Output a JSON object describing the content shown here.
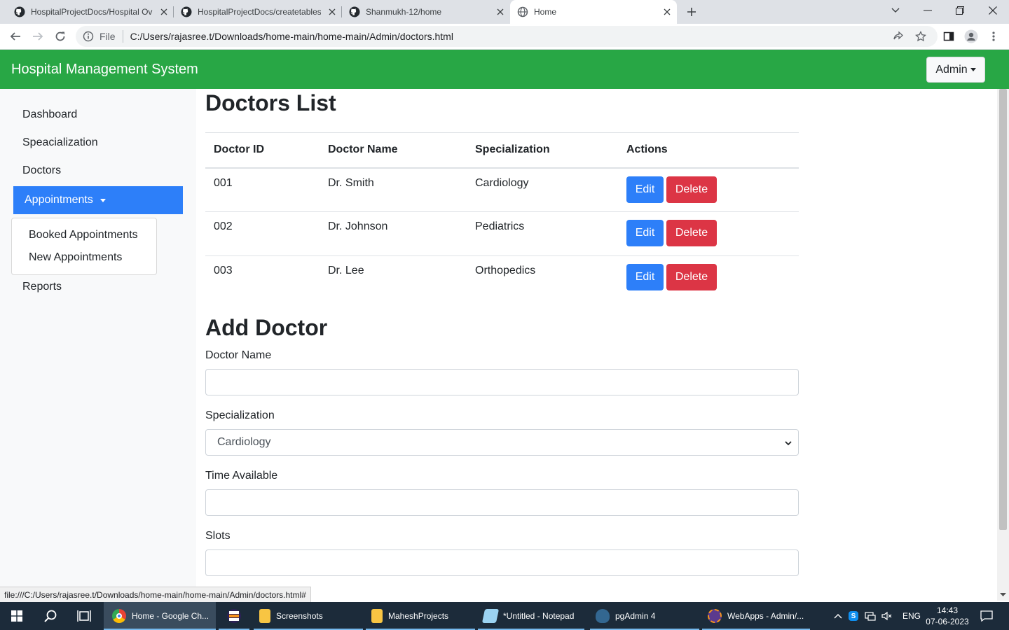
{
  "browser": {
    "tabs": [
      {
        "title": "HospitalProjectDocs/Hospital Ov",
        "icon": "github-icon",
        "active": false
      },
      {
        "title": "HospitalProjectDocs/createtables",
        "icon": "github-icon",
        "active": false
      },
      {
        "title": "Shanmukh-12/home",
        "icon": "github-icon",
        "active": false
      },
      {
        "title": "Home",
        "icon": "globe-icon",
        "active": true
      }
    ],
    "omnibox_scheme_label": "File",
    "url": "C:/Users/rajasree.t/Downloads/home-main/home-main/Admin/doctors.html",
    "status_url": "file:///C:/Users/rajasree.t/Downloads/home-main/home-main/Admin/doctors.html#"
  },
  "navbar": {
    "brand": "Hospital Management System",
    "admin_label": "Admin",
    "color": "#28a745"
  },
  "sidebar": {
    "items": [
      {
        "label": "Dashboard"
      },
      {
        "label": "Speacialization"
      },
      {
        "label": "Doctors"
      },
      {
        "label": "Appointments"
      },
      {
        "label": "Reports"
      }
    ],
    "appointments_menu": [
      {
        "label": "Booked Appointments"
      },
      {
        "label": "New Appointments"
      }
    ],
    "active_color": "#2d7ff9"
  },
  "doctors_list": {
    "title": "Doctors List",
    "columns": [
      "Doctor ID",
      "Doctor Name",
      "Specialization",
      "Actions"
    ],
    "rows": [
      {
        "id": "001",
        "name": "Dr. Smith",
        "specialization": "Cardiology"
      },
      {
        "id": "002",
        "name": "Dr. Johnson",
        "specialization": "Pediatrics"
      },
      {
        "id": "003",
        "name": "Dr. Lee",
        "specialization": "Orthopedics"
      }
    ],
    "edit_label": "Edit",
    "delete_label": "Delete",
    "edit_color": "#2d7ff9",
    "delete_color": "#dc3545"
  },
  "add_doctor": {
    "title": "Add Doctor",
    "name_label": "Doctor Name",
    "name_value": "",
    "specialization_label": "Specialization",
    "specialization_selected": "Cardiology",
    "time_label": "Time Available",
    "time_value": "",
    "slots_label": "Slots",
    "slots_value": ""
  },
  "taskbar": {
    "apps": [
      {
        "label": "Home - Google Ch...",
        "icon": "chrome-icon",
        "active": true
      },
      {
        "label": "",
        "icon": "eclipse-icon",
        "active": false
      },
      {
        "label": "Screenshots",
        "icon": "folder-icon",
        "active": false
      },
      {
        "label": "MaheshProjects",
        "icon": "folder-icon",
        "active": false
      },
      {
        "label": "*Untitled - Notepad",
        "icon": "notepad-icon",
        "active": false
      },
      {
        "label": "pgAdmin 4",
        "icon": "pgadmin-icon",
        "active": false
      },
      {
        "label": "WebApps - Admin/...",
        "icon": "eclipse-ee-icon",
        "active": false
      }
    ],
    "language": "ENG",
    "time": "14:43",
    "date": "07-06-2023"
  }
}
